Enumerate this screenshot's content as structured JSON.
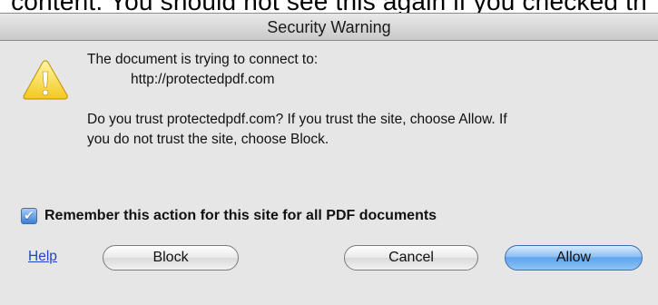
{
  "background_text": "content. You should not see this again if you checked th",
  "dialog": {
    "title": "Security Warning",
    "icon": "warning-icon",
    "message": {
      "line1": "The document is trying to connect to:",
      "url": "http://protectedpdf.com",
      "line3": "Do you trust protectedpdf.com? If you trust the site, choose Allow. If",
      "line4": "you do not trust the site, choose Block."
    },
    "checkbox": {
      "label": "Remember this action for this site for all PDF documents",
      "checked": true
    },
    "help_link": "Help",
    "buttons": {
      "block": "Block",
      "cancel": "Cancel",
      "allow": "Allow"
    },
    "colors": {
      "default_button": "#6aaaee",
      "link": "#1f45c8",
      "checkbox": "#3a7fd8"
    }
  }
}
